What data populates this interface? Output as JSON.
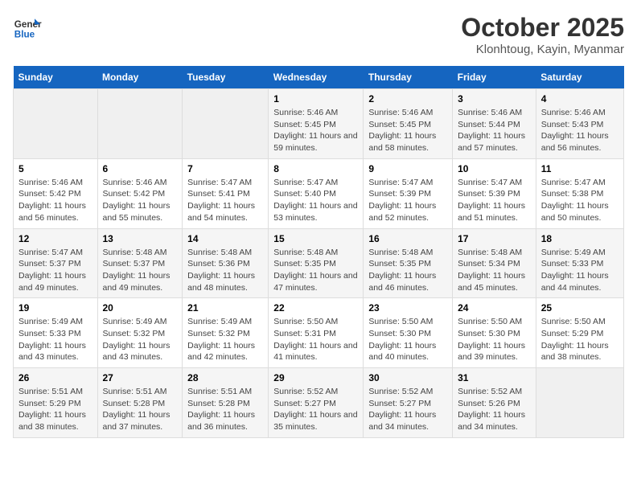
{
  "header": {
    "logo_line1": "General",
    "logo_line2": "Blue",
    "month_title": "October 2025",
    "location": "Klonhtoug, Kayin, Myanmar"
  },
  "weekdays": [
    "Sunday",
    "Monday",
    "Tuesday",
    "Wednesday",
    "Thursday",
    "Friday",
    "Saturday"
  ],
  "weeks": [
    [
      {
        "day": "",
        "empty": true
      },
      {
        "day": "",
        "empty": true
      },
      {
        "day": "",
        "empty": true
      },
      {
        "day": "1",
        "sunrise": "5:46 AM",
        "sunset": "5:45 PM",
        "daylight": "11 hours and 59 minutes."
      },
      {
        "day": "2",
        "sunrise": "5:46 AM",
        "sunset": "5:45 PM",
        "daylight": "11 hours and 58 minutes."
      },
      {
        "day": "3",
        "sunrise": "5:46 AM",
        "sunset": "5:44 PM",
        "daylight": "11 hours and 57 minutes."
      },
      {
        "day": "4",
        "sunrise": "5:46 AM",
        "sunset": "5:43 PM",
        "daylight": "11 hours and 56 minutes."
      }
    ],
    [
      {
        "day": "5",
        "sunrise": "5:46 AM",
        "sunset": "5:42 PM",
        "daylight": "11 hours and 56 minutes."
      },
      {
        "day": "6",
        "sunrise": "5:46 AM",
        "sunset": "5:42 PM",
        "daylight": "11 hours and 55 minutes."
      },
      {
        "day": "7",
        "sunrise": "5:47 AM",
        "sunset": "5:41 PM",
        "daylight": "11 hours and 54 minutes."
      },
      {
        "day": "8",
        "sunrise": "5:47 AM",
        "sunset": "5:40 PM",
        "daylight": "11 hours and 53 minutes."
      },
      {
        "day": "9",
        "sunrise": "5:47 AM",
        "sunset": "5:39 PM",
        "daylight": "11 hours and 52 minutes."
      },
      {
        "day": "10",
        "sunrise": "5:47 AM",
        "sunset": "5:39 PM",
        "daylight": "11 hours and 51 minutes."
      },
      {
        "day": "11",
        "sunrise": "5:47 AM",
        "sunset": "5:38 PM",
        "daylight": "11 hours and 50 minutes."
      }
    ],
    [
      {
        "day": "12",
        "sunrise": "5:47 AM",
        "sunset": "5:37 PM",
        "daylight": "11 hours and 49 minutes."
      },
      {
        "day": "13",
        "sunrise": "5:48 AM",
        "sunset": "5:37 PM",
        "daylight": "11 hours and 49 minutes."
      },
      {
        "day": "14",
        "sunrise": "5:48 AM",
        "sunset": "5:36 PM",
        "daylight": "11 hours and 48 minutes."
      },
      {
        "day": "15",
        "sunrise": "5:48 AM",
        "sunset": "5:35 PM",
        "daylight": "11 hours and 47 minutes."
      },
      {
        "day": "16",
        "sunrise": "5:48 AM",
        "sunset": "5:35 PM",
        "daylight": "11 hours and 46 minutes."
      },
      {
        "day": "17",
        "sunrise": "5:48 AM",
        "sunset": "5:34 PM",
        "daylight": "11 hours and 45 minutes."
      },
      {
        "day": "18",
        "sunrise": "5:49 AM",
        "sunset": "5:33 PM",
        "daylight": "11 hours and 44 minutes."
      }
    ],
    [
      {
        "day": "19",
        "sunrise": "5:49 AM",
        "sunset": "5:33 PM",
        "daylight": "11 hours and 43 minutes."
      },
      {
        "day": "20",
        "sunrise": "5:49 AM",
        "sunset": "5:32 PM",
        "daylight": "11 hours and 43 minutes."
      },
      {
        "day": "21",
        "sunrise": "5:49 AM",
        "sunset": "5:32 PM",
        "daylight": "11 hours and 42 minutes."
      },
      {
        "day": "22",
        "sunrise": "5:50 AM",
        "sunset": "5:31 PM",
        "daylight": "11 hours and 41 minutes."
      },
      {
        "day": "23",
        "sunrise": "5:50 AM",
        "sunset": "5:30 PM",
        "daylight": "11 hours and 40 minutes."
      },
      {
        "day": "24",
        "sunrise": "5:50 AM",
        "sunset": "5:30 PM",
        "daylight": "11 hours and 39 minutes."
      },
      {
        "day": "25",
        "sunrise": "5:50 AM",
        "sunset": "5:29 PM",
        "daylight": "11 hours and 38 minutes."
      }
    ],
    [
      {
        "day": "26",
        "sunrise": "5:51 AM",
        "sunset": "5:29 PM",
        "daylight": "11 hours and 38 minutes."
      },
      {
        "day": "27",
        "sunrise": "5:51 AM",
        "sunset": "5:28 PM",
        "daylight": "11 hours and 37 minutes."
      },
      {
        "day": "28",
        "sunrise": "5:51 AM",
        "sunset": "5:28 PM",
        "daylight": "11 hours and 36 minutes."
      },
      {
        "day": "29",
        "sunrise": "5:52 AM",
        "sunset": "5:27 PM",
        "daylight": "11 hours and 35 minutes."
      },
      {
        "day": "30",
        "sunrise": "5:52 AM",
        "sunset": "5:27 PM",
        "daylight": "11 hours and 34 minutes."
      },
      {
        "day": "31",
        "sunrise": "5:52 AM",
        "sunset": "5:26 PM",
        "daylight": "11 hours and 34 minutes."
      },
      {
        "day": "",
        "empty": true
      }
    ]
  ]
}
